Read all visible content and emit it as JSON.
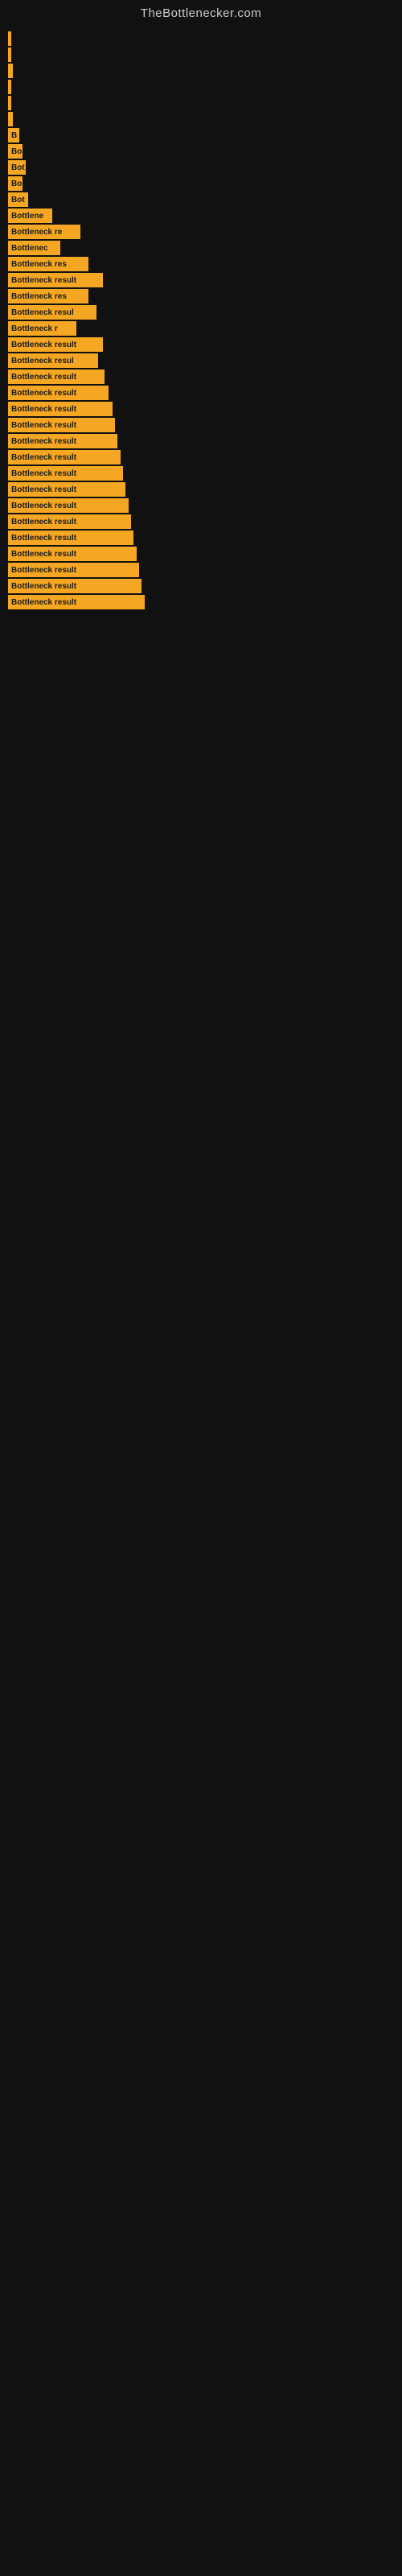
{
  "site": {
    "title": "TheBottlenecker.com"
  },
  "bars": [
    {
      "label": "",
      "width": 4
    },
    {
      "label": "",
      "width": 4
    },
    {
      "label": "",
      "width": 6
    },
    {
      "label": "",
      "width": 4
    },
    {
      "label": "",
      "width": 4
    },
    {
      "label": "",
      "width": 6
    },
    {
      "label": "B",
      "width": 14
    },
    {
      "label": "Bo",
      "width": 18
    },
    {
      "label": "Bot",
      "width": 22
    },
    {
      "label": "Bo",
      "width": 18
    },
    {
      "label": "Bot",
      "width": 25
    },
    {
      "label": "Bottlene",
      "width": 55
    },
    {
      "label": "Bottleneck re",
      "width": 90
    },
    {
      "label": "Bottlenec",
      "width": 65
    },
    {
      "label": "Bottleneck res",
      "width": 100
    },
    {
      "label": "Bottleneck result",
      "width": 118
    },
    {
      "label": "Bottleneck res",
      "width": 100
    },
    {
      "label": "Bottleneck resul",
      "width": 110
    },
    {
      "label": "Bottleneck r",
      "width": 85
    },
    {
      "label": "Bottleneck result",
      "width": 118
    },
    {
      "label": "Bottleneck resul",
      "width": 112
    },
    {
      "label": "Bottleneck result",
      "width": 120
    },
    {
      "label": "Bottleneck result",
      "width": 125
    },
    {
      "label": "Bottleneck result",
      "width": 130
    },
    {
      "label": "Bottleneck result",
      "width": 133
    },
    {
      "label": "Bottleneck result",
      "width": 136
    },
    {
      "label": "Bottleneck result",
      "width": 140
    },
    {
      "label": "Bottleneck result",
      "width": 143
    },
    {
      "label": "Bottleneck result",
      "width": 146
    },
    {
      "label": "Bottleneck result",
      "width": 150
    },
    {
      "label": "Bottleneck result",
      "width": 153
    },
    {
      "label": "Bottleneck result",
      "width": 156
    },
    {
      "label": "Bottleneck result",
      "width": 160
    },
    {
      "label": "Bottleneck result",
      "width": 163
    },
    {
      "label": "Bottleneck result",
      "width": 166
    },
    {
      "label": "Bottleneck result",
      "width": 170
    }
  ]
}
